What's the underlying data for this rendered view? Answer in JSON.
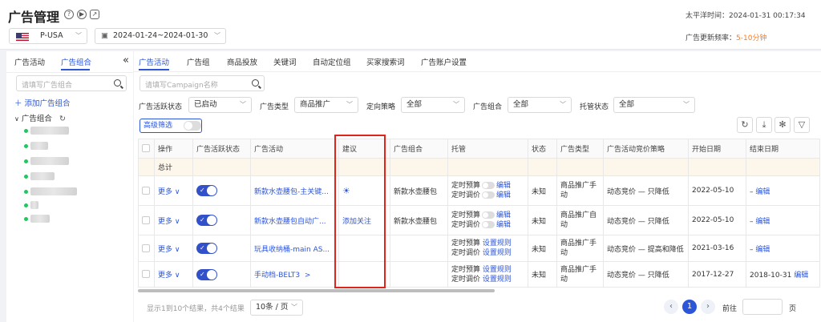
{
  "header": {
    "title": "广告管理",
    "icons": [
      "help-icon",
      "play-icon",
      "share-icon"
    ],
    "timezone_label": "太平洋时间：",
    "timezone_value": "2024-01-31 00:17:34",
    "refresh_label": "广告更新频率：",
    "refresh_value": "5-10分钟",
    "store_select": "P-USA",
    "date_range": "2024-01-24~2024-01-30",
    "accent": "#2c55d8",
    "refresh_color": "#ff7a1a"
  },
  "sidebar": {
    "tabs": [
      "广告活动",
      "广告组合"
    ],
    "active_tab": 1,
    "collapse_glyph": "«",
    "search_placeholder": "请填写广告组合",
    "add_label": "添加广告组合",
    "group_label": "广告组合",
    "group_items_count_shown": 7
  },
  "main": {
    "tabs": [
      "广告活动",
      "广告组",
      "商品投放",
      "关键词",
      "自动定位组",
      "买家搜索词",
      "广告账户设置"
    ],
    "active_tab": 0,
    "search_placeholder": "请填写Campaign名称",
    "filters": [
      {
        "label": "广告活跃状态",
        "value": "已启动"
      },
      {
        "label": "广告类型",
        "value": "商品推广"
      },
      {
        "label": "定向策略",
        "value": "全部"
      },
      {
        "label": "广告组合",
        "value": "全部"
      },
      {
        "label": "托管状态",
        "value": "全部"
      }
    ],
    "advanced_filter": "高级筛选"
  },
  "table": {
    "headers": [
      "操作",
      "广告活跃状态",
      "广告活动",
      "建议",
      "广告组合",
      "托管",
      "状态",
      "广告类型",
      "广告活动竞价策略",
      "开始日期",
      "结束日期"
    ],
    "total_label": "总计",
    "more_label": "更多",
    "rows": [
      {
        "campaign": "新款水壶腰包-主关键...",
        "suggestion": "",
        "suggestion_icon": "lightbulb-icon",
        "portfolio": "新款水壶腰包",
        "budget": "定时预算",
        "bid": "定时调价",
        "budget_action": "编辑",
        "bid_action": "编辑",
        "status": "未知",
        "type": "商品推广手动",
        "strategy": "动态竞价 — 只降低",
        "start": "2022-05-10",
        "end": "–",
        "end_action": "编辑"
      },
      {
        "campaign": "新款水壶腰包自动广...",
        "suggestion": "添加关注",
        "suggestion_icon": "",
        "portfolio": "新款水壶腰包",
        "budget": "定时预算",
        "bid": "定时调价",
        "budget_action": "编辑",
        "bid_action": "编辑",
        "status": "未知",
        "type": "商品推广自动",
        "strategy": "动态竞价 — 只降低",
        "start": "2022-05-10",
        "end": "–",
        "end_action": "编辑"
      },
      {
        "campaign": "玩具收纳桶-main AS...",
        "suggestion": "",
        "suggestion_icon": "",
        "portfolio": "",
        "budget": "定时预算",
        "bid": "定时调价",
        "budget_action": "设置规则",
        "bid_action": "设置规则",
        "status": "未知",
        "type": "商品推广手动",
        "strategy": "动态竞价 — 提高和降低",
        "start": "2021-03-16",
        "end": "–",
        "end_action": "编辑"
      },
      {
        "campaign": "手动档-BELT3",
        "suggestion": "",
        "suggestion_icon": "",
        "portfolio": "",
        "budget": "定时预算",
        "bid": "定时调价",
        "budget_action": "设置规则",
        "bid_action": "设置规则",
        "status": "未知",
        "type": "商品推广手动",
        "strategy": "动态竞价 — 只降低",
        "start": "2017-12-27",
        "end": "2018-10-31",
        "end_action": "编辑"
      }
    ]
  },
  "footer": {
    "summary": "显示1到10个结果，共4个结果",
    "page_size": "10条 / 页",
    "current_page": "1",
    "goto_label": "前往",
    "page_unit": "页"
  }
}
